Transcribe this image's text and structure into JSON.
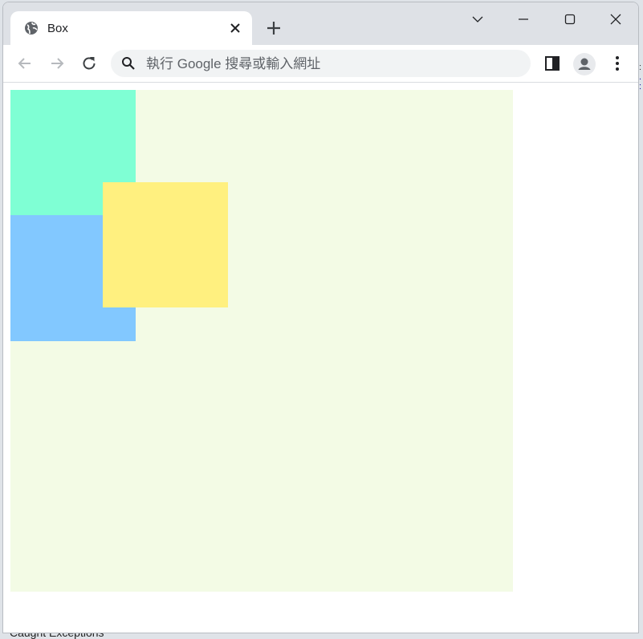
{
  "tab": {
    "title": "Box",
    "favicon": "globe-icon"
  },
  "toolbar": {
    "address_placeholder": "執行 Google 搜尋或輸入網址",
    "back_icon": "back-arrow-icon",
    "forward_icon": "forward-arrow-icon",
    "reload_icon": "reload-icon",
    "side_panel_icon": "side-panel-icon",
    "profile_icon": "profile-icon",
    "menu_icon": "kebab-menu-icon"
  },
  "window_controls": [
    "tab-search",
    "minimize",
    "maximize",
    "close"
  ],
  "background": {
    "debugger_text": "Caught Exceptions"
  },
  "page": {
    "container_color": "#f3fbe5",
    "boxes": [
      {
        "name": "aquamarine-box",
        "color": "#7fffd4"
      },
      {
        "name": "light-blue-box",
        "color": "#82c8ff"
      },
      {
        "name": "yellow-box",
        "color": "#fff07f"
      }
    ]
  }
}
